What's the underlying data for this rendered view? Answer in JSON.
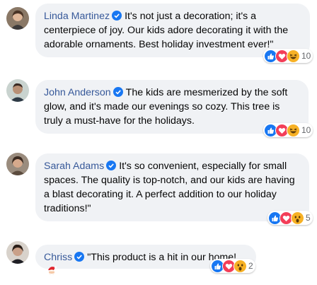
{
  "comments": [
    {
      "author": "Linda Martinez",
      "text": "It's not just a decoration; it's a centerpiece of joy. Our kids adore decorating it with the adorable ornaments. Best holiday investment ever!\"",
      "reactions": [
        "like",
        "love",
        "haha"
      ],
      "reaction_count": "10"
    },
    {
      "author": "John Anderson",
      "text": "The kids are mesmerized by the soft glow, and it's made our evenings so cozy. This tree is truly a must-have for the holidays.",
      "reactions": [
        "like",
        "love",
        "haha"
      ],
      "reaction_count": "10"
    },
    {
      "author": "Sarah Adams",
      "text": "It's so convenient, especially for small spaces. The quality is top-notch, and our kids are having a blast decorating it. A perfect addition to our holiday traditions!\"",
      "reactions": [
        "like",
        "love",
        "wow"
      ],
      "reaction_count": "5"
    },
    {
      "author": "Chriss",
      "text": "\"This product is a hit in our home!",
      "emoji": "santa-emoji",
      "reactions": [
        "like",
        "love",
        "wow"
      ],
      "reaction_count": "2"
    }
  ],
  "colors": {
    "author": "#365899",
    "bubble": "#f0f2f5",
    "verified": "#1877f2",
    "like": "#1877f2",
    "love": "#f33e58",
    "haha": "#f7b125"
  }
}
